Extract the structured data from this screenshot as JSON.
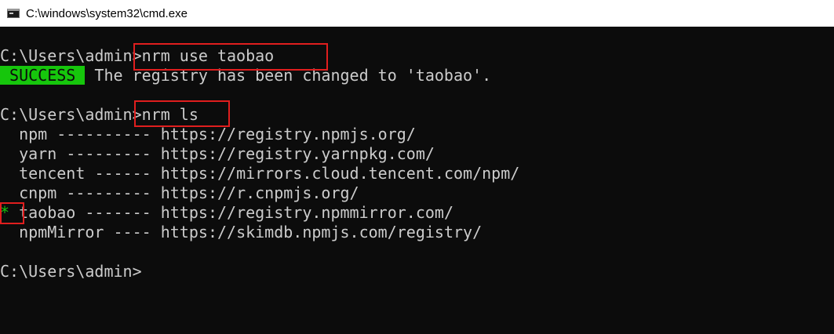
{
  "window": {
    "title": "C:\\windows\\system32\\cmd.exe",
    "icon": "console-app-icon"
  },
  "console": {
    "cmd1": {
      "prompt": "C:\\Users\\admin>",
      "command": "nrm use taobao"
    },
    "success": {
      "badge": " SUCCESS ",
      "message": " The registry has been changed to 'taobao'."
    },
    "cmd2": {
      "prompt": "C:\\Users\\admin>",
      "command": "nrm ls"
    },
    "registries": [
      {
        "marker": " ",
        "name": "npm",
        "dashes": "----------",
        "url": "https://registry.npmjs.org/"
      },
      {
        "marker": " ",
        "name": "yarn",
        "dashes": "---------",
        "url": "https://registry.yarnpkg.com/"
      },
      {
        "marker": " ",
        "name": "tencent",
        "dashes": "------",
        "url": "https://mirrors.cloud.tencent.com/npm/"
      },
      {
        "marker": " ",
        "name": "cnpm",
        "dashes": "---------",
        "url": "https://r.cnpmjs.org/"
      },
      {
        "marker": "*",
        "name": "taobao",
        "dashes": "-------",
        "url": "https://registry.npmmirror.com/"
      },
      {
        "marker": " ",
        "name": "npmMirror",
        "dashes": "----",
        "url": "https://skimdb.npmjs.com/registry/"
      }
    ],
    "cmd3": {
      "prompt": "C:\\Users\\admin>",
      "command": ""
    }
  },
  "colors": {
    "background": "#0c0c0c",
    "foreground": "#cccccc",
    "success": "#16c60c",
    "annotation": "#e01e1e"
  }
}
